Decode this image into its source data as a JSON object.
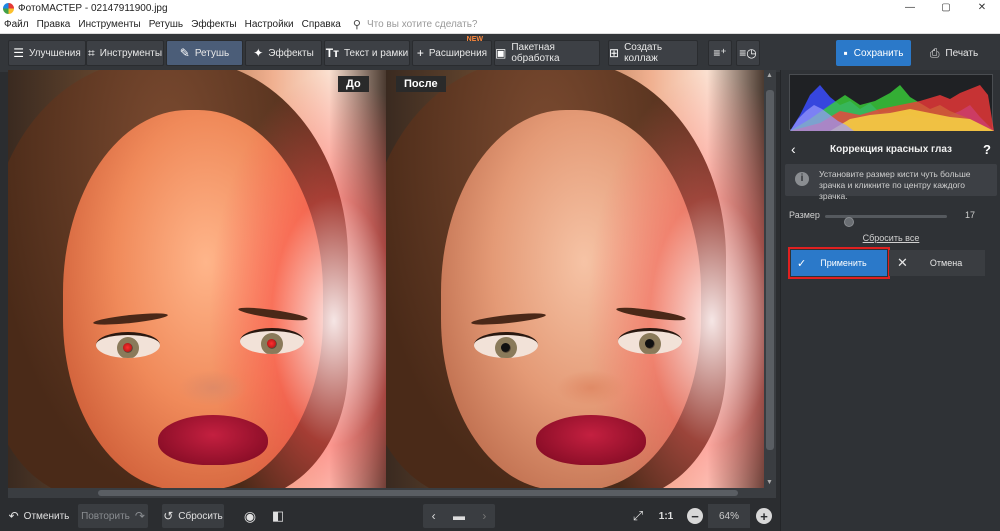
{
  "window": {
    "title": "ФотоМАСТЕР - 02147911900.jpg",
    "controls": {
      "minimize": "—",
      "maximize": "▢",
      "close": "✕"
    }
  },
  "menu": {
    "items": [
      "Файл",
      "Правка",
      "Инструменты",
      "Ретушь",
      "Эффекты",
      "Настройки",
      "Справка"
    ],
    "search_placeholder": "Что вы хотите сделать?"
  },
  "toolbar": {
    "tabs": [
      {
        "label": "Улучшения",
        "icon": "sliders-icon"
      },
      {
        "label": "Инструменты",
        "icon": "crop-icon"
      },
      {
        "label": "Ретушь",
        "icon": "brush-icon",
        "active": true
      },
      {
        "label": "Эффекты",
        "icon": "sparkle-icon"
      },
      {
        "label": "Текст и рамки",
        "icon": "text-icon"
      },
      {
        "label": "Расширения",
        "icon": "plus-icon",
        "badge": "NEW"
      },
      {
        "label": "Пакетная обработка",
        "icon": "images-icon"
      },
      {
        "label": "Создать коллаж",
        "icon": "collage-icon"
      }
    ],
    "save_label": "Сохранить",
    "print_label": "Печать"
  },
  "canvas": {
    "before_label": "До",
    "after_label": "После"
  },
  "bottom": {
    "undo_label": "Отменить",
    "redo_label": "Повторить",
    "reset_label": "Сбросить",
    "zoom_ratio": "1:1",
    "zoom_value": "64%"
  },
  "panel": {
    "title": "Коррекция красных глаз",
    "back": "‹",
    "help": "?",
    "hint": "Установите размер кисти чуть больше зрачка и кликните по центру каждого зрачка.",
    "size_label": "Размер",
    "size_value": "17",
    "size_slider_fraction": 0.17,
    "reset_all_label": "Сбросить все",
    "apply_label": "Применить",
    "cancel_label": "Отмена"
  },
  "colors": {
    "accent": "#2b79c9",
    "highlight": "#e02020",
    "toolbar_bg": "#33363a",
    "panel_bg": "#2f3236"
  }
}
